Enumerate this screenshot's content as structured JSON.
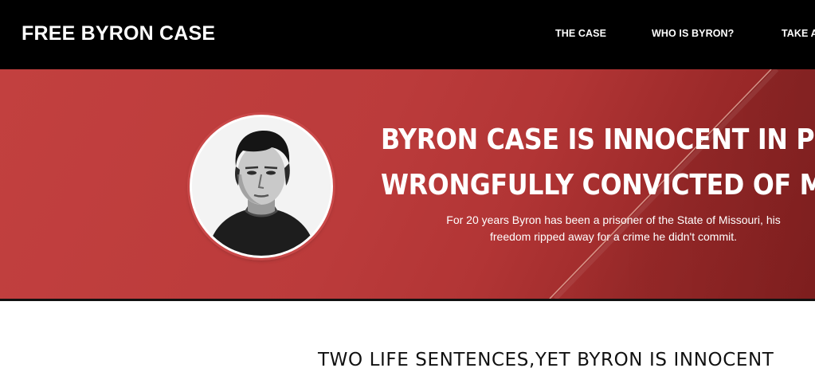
{
  "header": {
    "site_title": "FREE BYRON CASE",
    "nav": [
      {
        "label": "THE CASE"
      },
      {
        "label": "WHO IS BYRON?"
      },
      {
        "label": "TAKE A"
      }
    ]
  },
  "hero": {
    "headline_line1": "BYRON CASE IS INNOCENT IN PRISO",
    "headline_line2": "WRONGFULLY CONVICTED OF MURD",
    "subtext": "For 20 years Byron has been a prisoner of the State of Missouri, his freedom ripped away for a crime he didn't commit.",
    "portrait_alt": "Photo of Byron Case"
  },
  "section": {
    "title": "TWO LIFE SENTENCES,YET BYRON IS INNOCENT"
  },
  "colors": {
    "header_bg": "#000000",
    "hero_red": "#bb3b3b",
    "hero_dark_red": "#8e2222",
    "text_light": "#ffffff",
    "text_dark": "#111111"
  }
}
